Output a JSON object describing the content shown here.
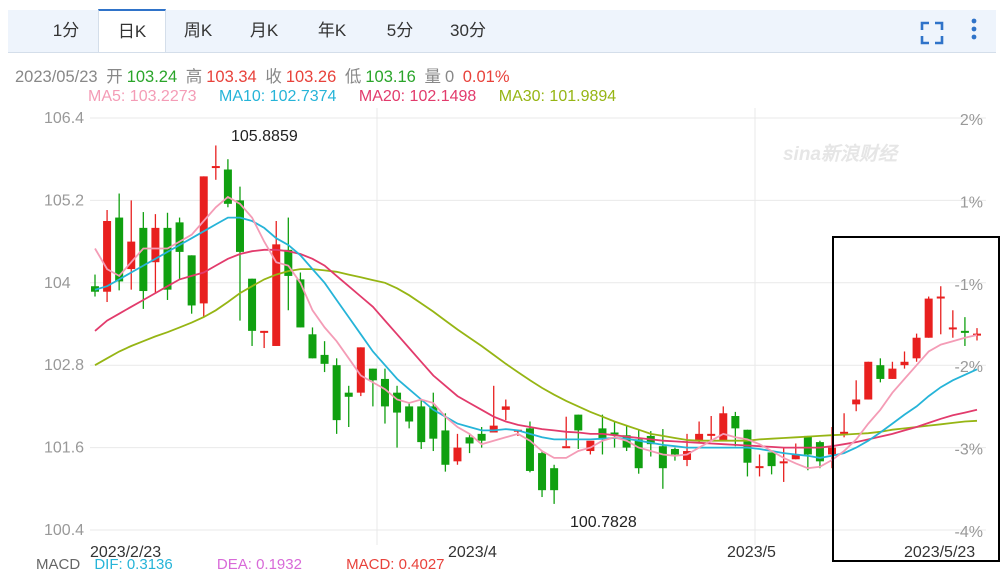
{
  "tabs": [
    {
      "label": "1分",
      "active": false
    },
    {
      "label": "日K",
      "active": true
    },
    {
      "label": "周K",
      "active": false
    },
    {
      "label": "月K",
      "active": false
    },
    {
      "label": "年K",
      "active": false
    },
    {
      "label": "5分",
      "active": false
    },
    {
      "label": "30分",
      "active": false
    }
  ],
  "toolbar": {
    "fullscreen_icon": "fullscreen-icon",
    "more_icon": "more-vertical-icon",
    "accent": "#2f73c9"
  },
  "info": {
    "date": "2023/05/23",
    "open_label": "开",
    "open": "103.24",
    "high_label": "高",
    "high": "103.34",
    "close_label": "收",
    "close": "103.26",
    "low_label": "低",
    "low": "103.16",
    "vol_label": "量",
    "vol": "0",
    "change": "0.01%"
  },
  "ma": {
    "ma5": "MA5: 103.2273",
    "ma10": "MA10: 102.7374",
    "ma20": "MA20: 102.1498",
    "ma30": "MA30: 101.9894"
  },
  "colors": {
    "up": "#e8201f",
    "down": "#10a010",
    "ma5": "#f49cb6",
    "ma10": "#26b4d8",
    "ma20": "#e23b6c",
    "ma30": "#96b514"
  },
  "watermark": "sina新浪财经",
  "macd_legend": {
    "macd": "MACD",
    "dif": "DIF: 0.3136",
    "dea": "DEA: 0.1932",
    "macd_val": "MACD: 0.4027"
  },
  "chart_data": {
    "type": "candlestick",
    "ylim": [
      100.4,
      106.4
    ],
    "yticks": [
      "106.4",
      "105.2",
      "104",
      "102.8",
      "101.6",
      "100.4"
    ],
    "pct_ticks": [
      "2%",
      "1%",
      "-1%",
      "-2%",
      "-3%",
      "-4%"
    ],
    "xticks": [
      "2023/2/23",
      "2023/4",
      "2023/5",
      "2023/5/23"
    ],
    "annotations": {
      "max": "105.8859",
      "min": "100.7828"
    },
    "candles": [
      [
        103.95,
        103.87,
        104.12,
        103.8
      ],
      [
        103.87,
        104.9,
        105.06,
        103.72
      ],
      [
        104.95,
        104.02,
        105.3,
        103.89
      ],
      [
        104.2,
        104.6,
        105.2,
        103.9
      ],
      [
        104.8,
        103.88,
        105.03,
        103.62
      ],
      [
        104.3,
        104.8,
        105.0,
        103.85
      ],
      [
        104.8,
        103.9,
        105.02,
        103.75
      ],
      [
        104.88,
        104.45,
        104.95,
        104.05
      ],
      [
        104.4,
        103.67,
        104.4,
        103.55
      ],
      [
        103.7,
        105.55,
        105.55,
        103.5
      ],
      [
        105.7,
        105.7,
        106.0,
        105.5
      ],
      [
        105.65,
        105.15,
        105.8,
        105.1
      ],
      [
        105.2,
        104.45,
        105.4,
        103.45
      ],
      [
        104.06,
        103.3,
        104.06,
        103.08
      ],
      [
        103.3,
        103.3,
        103.3,
        103.05
      ],
      [
        103.08,
        104.56,
        104.9,
        103.08
      ],
      [
        104.48,
        104.1,
        104.95,
        103.6
      ],
      [
        104.05,
        103.35,
        104.15,
        103.35
      ],
      [
        103.25,
        102.9,
        103.35,
        102.9
      ],
      [
        102.95,
        102.82,
        103.15,
        102.7
      ],
      [
        102.8,
        102.0,
        102.9,
        101.8
      ],
      [
        102.4,
        102.34,
        102.5,
        101.9
      ],
      [
        102.4,
        103.06,
        103.06,
        102.35
      ],
      [
        102.75,
        102.58,
        102.75,
        102.2
      ],
      [
        102.6,
        102.2,
        102.75,
        101.95
      ],
      [
        102.4,
        102.11,
        102.5,
        101.6
      ],
      [
        102.2,
        101.98,
        102.25,
        101.88
      ],
      [
        102.2,
        101.68,
        102.3,
        101.58
      ],
      [
        102.2,
        101.73,
        102.4,
        101.55
      ],
      [
        101.85,
        101.35,
        102.1,
        101.25
      ],
      [
        101.4,
        101.6,
        101.8,
        101.35
      ],
      [
        101.75,
        101.66,
        101.8,
        101.52
      ],
      [
        101.8,
        101.7,
        101.9,
        101.6
      ],
      [
        101.82,
        101.92,
        102.5,
        101.85
      ],
      [
        102.15,
        102.2,
        102.3,
        102.0
      ],
      [
        101.86,
        101.86,
        101.86,
        101.77
      ],
      [
        101.88,
        101.26,
        101.98,
        101.24
      ],
      [
        101.52,
        100.98,
        101.55,
        100.88
      ],
      [
        101.3,
        100.98,
        101.35,
        100.78
      ],
      [
        101.62,
        101.62,
        102.05,
        101.62
      ],
      [
        102.08,
        101.85,
        102.08,
        101.58
      ],
      [
        101.55,
        101.7,
        101.55,
        101.5
      ],
      [
        101.88,
        101.73,
        102.08,
        101.5
      ],
      [
        101.82,
        101.81,
        101.98,
        101.6
      ],
      [
        101.78,
        101.6,
        101.92,
        101.55
      ],
      [
        101.72,
        101.3,
        101.86,
        101.22
      ],
      [
        101.77,
        101.65,
        101.84,
        101.47
      ],
      [
        101.62,
        101.3,
        101.87,
        101.0
      ],
      [
        101.58,
        101.5,
        101.6,
        101.41
      ],
      [
        101.42,
        101.55,
        101.8,
        101.33
      ],
      [
        101.71,
        101.8,
        101.98,
        101.68
      ],
      [
        101.8,
        101.8,
        102.06,
        101.7
      ],
      [
        101.71,
        102.1,
        102.2,
        101.7
      ],
      [
        102.06,
        101.88,
        102.12,
        101.62
      ],
      [
        101.86,
        101.38,
        101.86,
        101.18
      ],
      [
        101.33,
        101.33,
        101.5,
        101.18
      ],
      [
        101.53,
        101.33,
        101.53,
        101.21
      ],
      [
        101.4,
        101.4,
        101.6,
        101.1
      ],
      [
        101.43,
        101.5,
        101.66,
        101.43
      ],
      [
        101.77,
        101.5,
        101.77,
        101.27
      ],
      [
        101.68,
        101.4,
        101.7,
        101.3
      ],
      [
        101.5,
        101.6,
        101.9,
        101.3
      ],
      [
        101.8,
        101.83,
        102.1,
        101.75
      ],
      [
        102.23,
        102.3,
        102.58,
        102.13
      ],
      [
        102.3,
        102.85,
        102.85,
        102.3
      ],
      [
        102.8,
        102.6,
        102.9,
        102.55
      ],
      [
        102.6,
        102.75,
        102.85,
        102.6
      ],
      [
        102.8,
        102.85,
        103.0,
        102.75
      ],
      [
        102.9,
        103.2,
        103.26,
        102.85
      ],
      [
        103.2,
        103.77,
        103.8,
        103.2
      ],
      [
        103.8,
        103.8,
        103.95,
        103.25
      ],
      [
        103.35,
        103.35,
        103.6,
        103.2
      ],
      [
        103.3,
        103.28,
        103.5,
        103.08
      ],
      [
        103.24,
        103.26,
        103.34,
        103.16
      ]
    ],
    "ma5": [
      104.5,
      104.2,
      104.1,
      104.3,
      104.5,
      104.5,
      104.5,
      104.6,
      104.7,
      104.9,
      105.1,
      105.25,
      105.15,
      104.95,
      104.6,
      104.3,
      104.25,
      104.0,
      103.6,
      103.35,
      103.15,
      102.9,
      102.65,
      102.55,
      102.45,
      102.3,
      102.25,
      102.3,
      102.25,
      102.05,
      101.9,
      101.8,
      101.65,
      101.7,
      101.75,
      101.8,
      101.7,
      101.55,
      101.45,
      101.45,
      101.55,
      101.6,
      101.7,
      101.75,
      101.7,
      101.6,
      101.55,
      101.5,
      101.48,
      101.5,
      101.6,
      101.7,
      101.8,
      101.75,
      101.72,
      101.65,
      101.55,
      101.45,
      101.37,
      101.3,
      101.32,
      101.42,
      101.55,
      101.72,
      101.95,
      102.15,
      102.4,
      102.6,
      102.8,
      103.0,
      103.1,
      103.15,
      103.2,
      103.24
    ],
    "ma10": [
      103.9,
      103.95,
      104.05,
      104.15,
      104.25,
      104.35,
      104.45,
      104.55,
      104.65,
      104.75,
      104.85,
      104.95,
      104.95,
      104.9,
      104.8,
      104.65,
      104.55,
      104.4,
      104.2,
      104.0,
      103.75,
      103.5,
      103.25,
      103.0,
      102.8,
      102.6,
      102.45,
      102.3,
      102.15,
      102.05,
      101.95,
      101.9,
      101.85,
      101.85,
      101.87,
      101.85,
      101.8,
      101.75,
      101.72,
      101.72,
      101.72,
      101.72,
      101.73,
      101.74,
      101.73,
      101.7,
      101.67,
      101.64,
      101.62,
      101.6,
      101.6,
      101.6,
      101.6,
      101.6,
      101.6,
      101.58,
      101.55,
      101.52,
      101.5,
      101.48,
      101.45,
      101.48,
      101.52,
      101.6,
      101.7,
      101.82,
      101.95,
      102.08,
      102.2,
      102.35,
      102.48,
      102.58,
      102.66,
      102.74
    ],
    "ma20": [
      103.3,
      103.45,
      103.55,
      103.65,
      103.75,
      103.85,
      103.95,
      104.05,
      104.1,
      104.15,
      104.25,
      104.35,
      104.42,
      104.46,
      104.48,
      104.48,
      104.46,
      104.42,
      104.35,
      104.25,
      104.1,
      103.95,
      103.8,
      103.65,
      103.45,
      103.25,
      103.05,
      102.85,
      102.65,
      102.5,
      102.35,
      102.25,
      102.15,
      102.05,
      101.98,
      101.93,
      101.9,
      101.87,
      101.85,
      101.83,
      101.82,
      101.8,
      101.8,
      101.78,
      101.76,
      101.74,
      101.72,
      101.7,
      101.69,
      101.68,
      101.67,
      101.66,
      101.65,
      101.64,
      101.63,
      101.62,
      101.61,
      101.6,
      101.6,
      101.6,
      101.6,
      101.62,
      101.65,
      101.68,
      101.72,
      101.76,
      101.8,
      101.85,
      101.9,
      101.96,
      102.02,
      102.07,
      102.11,
      102.15
    ],
    "ma30": [
      102.8,
      102.9,
      103.0,
      103.08,
      103.15,
      103.22,
      103.28,
      103.35,
      103.42,
      103.5,
      103.6,
      103.72,
      103.85,
      103.95,
      104.05,
      104.12,
      104.17,
      104.2,
      104.2,
      104.18,
      104.16,
      104.12,
      104.08,
      104.04,
      104.0,
      103.92,
      103.82,
      103.7,
      103.58,
      103.45,
      103.32,
      103.2,
      103.08,
      102.95,
      102.82,
      102.7,
      102.58,
      102.47,
      102.37,
      102.28,
      102.2,
      102.12,
      102.05,
      101.98,
      101.92,
      101.86,
      101.8,
      101.77,
      101.74,
      101.71,
      101.7,
      101.7,
      101.7,
      101.7,
      101.7,
      101.72,
      101.73,
      101.74,
      101.75,
      101.76,
      101.77,
      101.78,
      101.79,
      101.8,
      101.81,
      101.83,
      101.86,
      101.88,
      101.9,
      101.92,
      101.94,
      101.96,
      101.98,
      101.99
    ]
  }
}
